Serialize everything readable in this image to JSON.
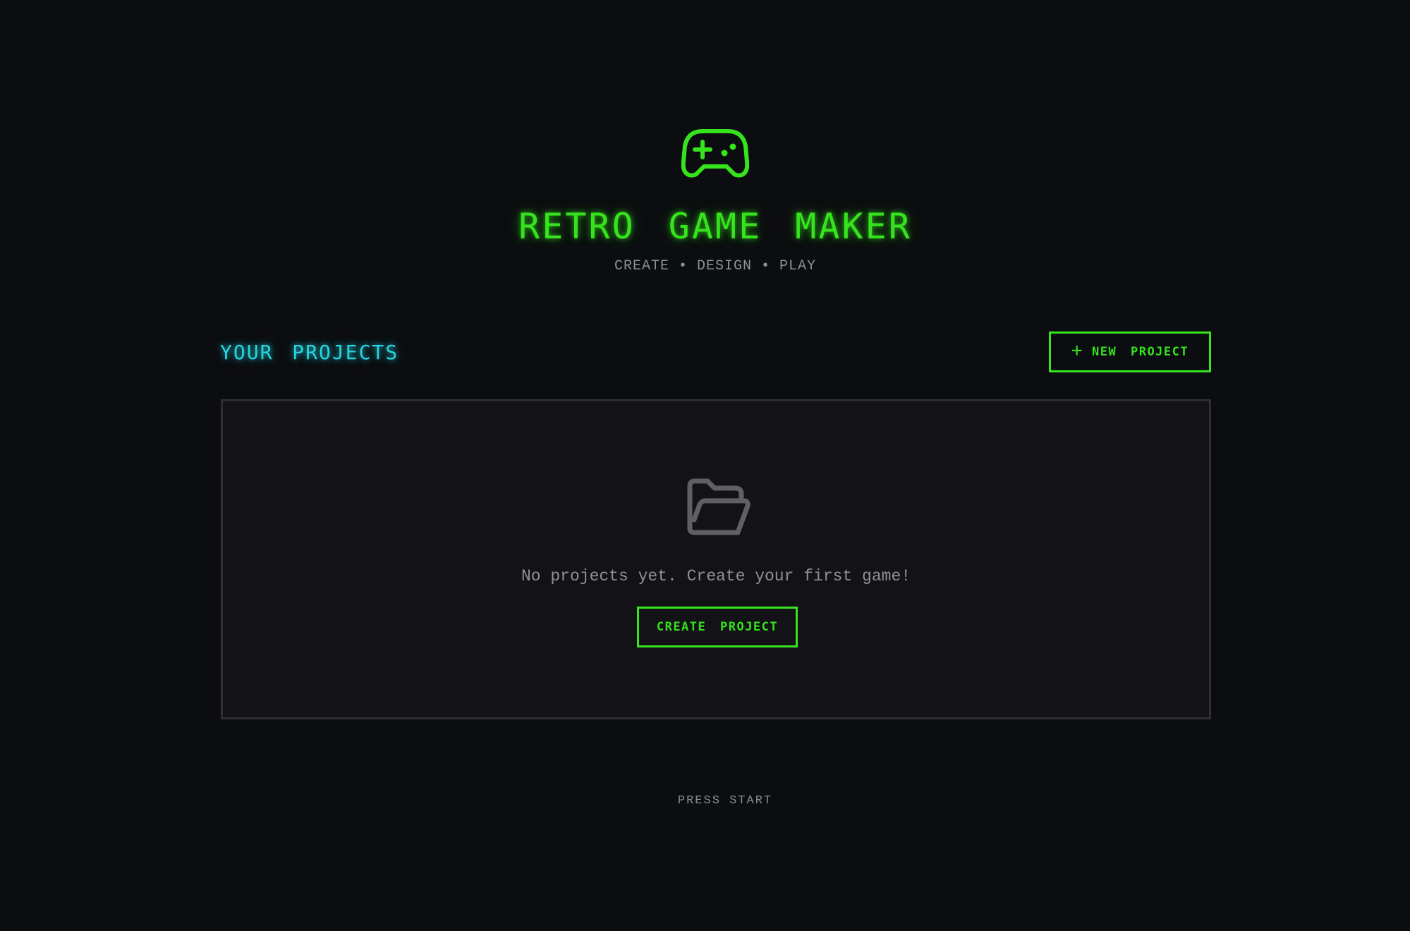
{
  "header": {
    "logo_icon": "gamepad-icon",
    "title": "RETRO GAME MAKER",
    "subtitle": "CREATE • DESIGN • PLAY"
  },
  "projects": {
    "section_title": "YOUR PROJECTS",
    "new_button": {
      "icon": "plus-icon",
      "label": "NEW PROJECT"
    },
    "empty_state": {
      "icon": "folder-open-icon",
      "message": "No projects yet. Create your first game!",
      "button_label": "CREATE PROJECT"
    }
  },
  "footer": {
    "text": "PRESS START"
  },
  "colors": {
    "background": "#0c0d10",
    "accent_green": "#35e41c",
    "accent_cyan": "#25d6e0",
    "muted_text": "#8f9196",
    "panel_background": "#121217",
    "panel_border": "#2e2f33"
  }
}
